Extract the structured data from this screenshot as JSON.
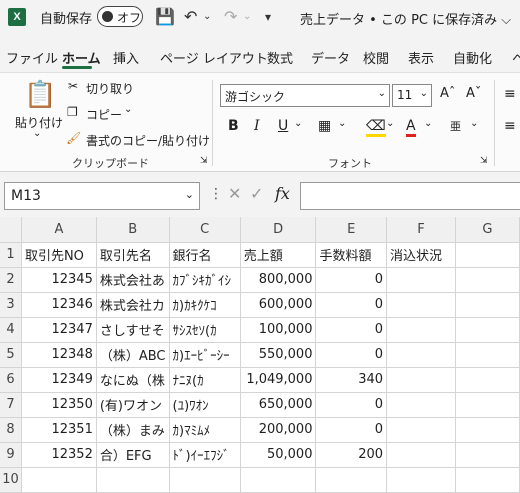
{
  "titlebar": {
    "app_logo": "X",
    "autosave_label": "自動保存",
    "autosave_state": "オフ",
    "doc_title": "売上データ • この PC に保存済み ⌵"
  },
  "tabs": [
    "ファイル",
    "ホーム",
    "挿入",
    "ページ レイアウト",
    "数式",
    "データ",
    "校閲",
    "表示",
    "自動化",
    "ヘ"
  ],
  "ribbon": {
    "paste_label": "貼り付け",
    "cut_label": "切り取り",
    "copy_label": "コピー",
    "format_painter_label": "書式のコピー/貼り付け",
    "clipboard_group": "クリップボード",
    "font_name": "游ゴシック",
    "font_size": "11",
    "font_group": "フォント"
  },
  "formula_bar": {
    "name_box": "M13",
    "fx_label": "fx",
    "formula": ""
  },
  "sheet": {
    "columns": [
      "A",
      "B",
      "C",
      "D",
      "E",
      "F",
      "G"
    ],
    "headers": [
      "取引先NO",
      "取引先名",
      "銀行名",
      "売上額",
      "手数料額",
      "消込状況"
    ],
    "rows": [
      {
        "no": "12345",
        "name": "株式会社あ",
        "bank": "ｶﾌﾞｼｷｶﾞｲｼ",
        "sales": "800,000",
        "fee": "0",
        "status": ""
      },
      {
        "no": "12346",
        "name": "株式会社カ",
        "bank": "ｶ)ｶｷｸｹｺ",
        "sales": "600,000",
        "fee": "0",
        "status": ""
      },
      {
        "no": "12347",
        "name": "さしすせそ",
        "bank": "ｻｼｽｾｿ(ｶ",
        "sales": "100,000",
        "fee": "0",
        "status": ""
      },
      {
        "no": "12348",
        "name": "（株）ABC",
        "bank": "ｶ)ｴｰﾋﾞｰｼｰ",
        "sales": "550,000",
        "fee": "0",
        "status": ""
      },
      {
        "no": "12349",
        "name": "なにぬ（株",
        "bank": "ﾅﾆﾇ(ｶ",
        "sales": "1,049,000",
        "fee": "340",
        "status": ""
      },
      {
        "no": "12350",
        "name": "(有)ワオン",
        "bank": "(ﾕ)ﾜｵﾝ",
        "sales": "650,000",
        "fee": "0",
        "status": ""
      },
      {
        "no": "12351",
        "name": "（株）まみ",
        "bank": "ｶ)ﾏﾐﾑﾒ",
        "sales": "200,000",
        "fee": "0",
        "status": ""
      },
      {
        "no": "12352",
        "name": "合）EFG",
        "bank": "ﾄﾞ)ｲｰｴﾌｼﾞ",
        "sales": "50,000",
        "fee": "200",
        "status": ""
      }
    ],
    "row_numbers": [
      "1",
      "2",
      "3",
      "4",
      "5",
      "6",
      "7",
      "8",
      "9",
      "10"
    ]
  }
}
